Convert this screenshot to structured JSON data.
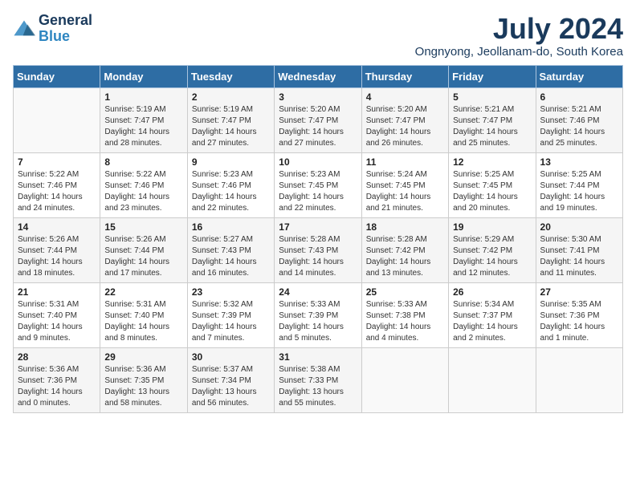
{
  "logo": {
    "line1": "General",
    "line2": "Blue"
  },
  "title": "July 2024",
  "location": "Ongnyong, Jeollanam-do, South Korea",
  "headers": [
    "Sunday",
    "Monday",
    "Tuesday",
    "Wednesday",
    "Thursday",
    "Friday",
    "Saturday"
  ],
  "weeks": [
    [
      {
        "day": "",
        "info": ""
      },
      {
        "day": "1",
        "info": "Sunrise: 5:19 AM\nSunset: 7:47 PM\nDaylight: 14 hours\nand 28 minutes."
      },
      {
        "day": "2",
        "info": "Sunrise: 5:19 AM\nSunset: 7:47 PM\nDaylight: 14 hours\nand 27 minutes."
      },
      {
        "day": "3",
        "info": "Sunrise: 5:20 AM\nSunset: 7:47 PM\nDaylight: 14 hours\nand 27 minutes."
      },
      {
        "day": "4",
        "info": "Sunrise: 5:20 AM\nSunset: 7:47 PM\nDaylight: 14 hours\nand 26 minutes."
      },
      {
        "day": "5",
        "info": "Sunrise: 5:21 AM\nSunset: 7:47 PM\nDaylight: 14 hours\nand 25 minutes."
      },
      {
        "day": "6",
        "info": "Sunrise: 5:21 AM\nSunset: 7:46 PM\nDaylight: 14 hours\nand 25 minutes."
      }
    ],
    [
      {
        "day": "7",
        "info": "Sunrise: 5:22 AM\nSunset: 7:46 PM\nDaylight: 14 hours\nand 24 minutes."
      },
      {
        "day": "8",
        "info": "Sunrise: 5:22 AM\nSunset: 7:46 PM\nDaylight: 14 hours\nand 23 minutes."
      },
      {
        "day": "9",
        "info": "Sunrise: 5:23 AM\nSunset: 7:46 PM\nDaylight: 14 hours\nand 22 minutes."
      },
      {
        "day": "10",
        "info": "Sunrise: 5:23 AM\nSunset: 7:45 PM\nDaylight: 14 hours\nand 22 minutes."
      },
      {
        "day": "11",
        "info": "Sunrise: 5:24 AM\nSunset: 7:45 PM\nDaylight: 14 hours\nand 21 minutes."
      },
      {
        "day": "12",
        "info": "Sunrise: 5:25 AM\nSunset: 7:45 PM\nDaylight: 14 hours\nand 20 minutes."
      },
      {
        "day": "13",
        "info": "Sunrise: 5:25 AM\nSunset: 7:44 PM\nDaylight: 14 hours\nand 19 minutes."
      }
    ],
    [
      {
        "day": "14",
        "info": "Sunrise: 5:26 AM\nSunset: 7:44 PM\nDaylight: 14 hours\nand 18 minutes."
      },
      {
        "day": "15",
        "info": "Sunrise: 5:26 AM\nSunset: 7:44 PM\nDaylight: 14 hours\nand 17 minutes."
      },
      {
        "day": "16",
        "info": "Sunrise: 5:27 AM\nSunset: 7:43 PM\nDaylight: 14 hours\nand 16 minutes."
      },
      {
        "day": "17",
        "info": "Sunrise: 5:28 AM\nSunset: 7:43 PM\nDaylight: 14 hours\nand 14 minutes."
      },
      {
        "day": "18",
        "info": "Sunrise: 5:28 AM\nSunset: 7:42 PM\nDaylight: 14 hours\nand 13 minutes."
      },
      {
        "day": "19",
        "info": "Sunrise: 5:29 AM\nSunset: 7:42 PM\nDaylight: 14 hours\nand 12 minutes."
      },
      {
        "day": "20",
        "info": "Sunrise: 5:30 AM\nSunset: 7:41 PM\nDaylight: 14 hours\nand 11 minutes."
      }
    ],
    [
      {
        "day": "21",
        "info": "Sunrise: 5:31 AM\nSunset: 7:40 PM\nDaylight: 14 hours\nand 9 minutes."
      },
      {
        "day": "22",
        "info": "Sunrise: 5:31 AM\nSunset: 7:40 PM\nDaylight: 14 hours\nand 8 minutes."
      },
      {
        "day": "23",
        "info": "Sunrise: 5:32 AM\nSunset: 7:39 PM\nDaylight: 14 hours\nand 7 minutes."
      },
      {
        "day": "24",
        "info": "Sunrise: 5:33 AM\nSunset: 7:39 PM\nDaylight: 14 hours\nand 5 minutes."
      },
      {
        "day": "25",
        "info": "Sunrise: 5:33 AM\nSunset: 7:38 PM\nDaylight: 14 hours\nand 4 minutes."
      },
      {
        "day": "26",
        "info": "Sunrise: 5:34 AM\nSunset: 7:37 PM\nDaylight: 14 hours\nand 2 minutes."
      },
      {
        "day": "27",
        "info": "Sunrise: 5:35 AM\nSunset: 7:36 PM\nDaylight: 14 hours\nand 1 minute."
      }
    ],
    [
      {
        "day": "28",
        "info": "Sunrise: 5:36 AM\nSunset: 7:36 PM\nDaylight: 14 hours\nand 0 minutes."
      },
      {
        "day": "29",
        "info": "Sunrise: 5:36 AM\nSunset: 7:35 PM\nDaylight: 13 hours\nand 58 minutes."
      },
      {
        "day": "30",
        "info": "Sunrise: 5:37 AM\nSunset: 7:34 PM\nDaylight: 13 hours\nand 56 minutes."
      },
      {
        "day": "31",
        "info": "Sunrise: 5:38 AM\nSunset: 7:33 PM\nDaylight: 13 hours\nand 55 minutes."
      },
      {
        "day": "",
        "info": ""
      },
      {
        "day": "",
        "info": ""
      },
      {
        "day": "",
        "info": ""
      }
    ]
  ]
}
